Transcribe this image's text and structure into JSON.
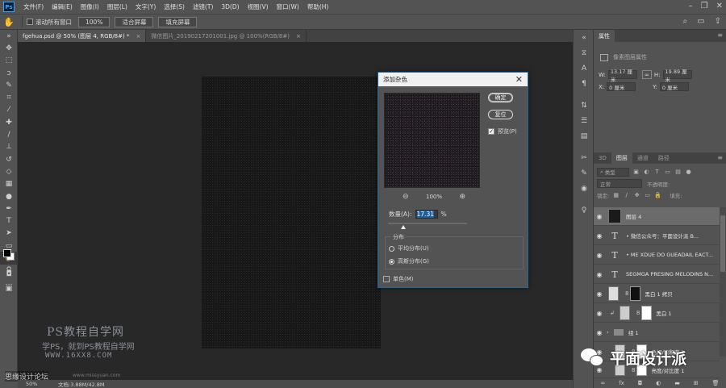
{
  "menubar": {
    "logo": "Ps",
    "items": [
      "文件(F)",
      "编辑(E)",
      "图像(I)",
      "图层(L)",
      "文字(Y)",
      "选择(S)",
      "滤镜(T)",
      "3D(D)",
      "视图(V)",
      "窗口(W)",
      "帮助(H)"
    ]
  },
  "optionsbar": {
    "scroll_all_label": "滚动所有窗口",
    "zoom_value": "100%",
    "fit_screen": "适合屏幕",
    "fill_screen": "填充屏幕"
  },
  "tabs": [
    {
      "label": "fgehua.psd @ 50% (图层 4, RGB/8#) *",
      "close": "×"
    },
    {
      "label": "微信图片_20190217201001.jpg @ 100%(RGB/8#)",
      "close": "×"
    }
  ],
  "dialog": {
    "title": "添加杂色",
    "close": "✕",
    "ok_label": "确定",
    "reset_label": "复位",
    "preview_label": "预览(P)",
    "preview_checked": true,
    "zoom": "100%",
    "amount_label": "数量(A):",
    "amount_value": "17.31",
    "amount_unit": "%",
    "distribution_label": "分布",
    "uniform_label": "平均分布(U)",
    "gaussian_label": "高斯分布(G)",
    "selected_distribution": "gaussian",
    "mono_label": "单色(M)",
    "mono_checked": false
  },
  "watermark": {
    "line1": "PS教程自学网",
    "line2": "学PS，就到PS教程自学网",
    "line3": "WWW.16XX8.COM",
    "line4": "思缘设计论坛",
    "line5": "www.missyuan.com"
  },
  "status": {
    "zoom": "50%",
    "doc": "文档:3.88M/42.8M"
  },
  "properties": {
    "tab": "属性",
    "subtitle": "像素图层属性",
    "w_label": "W:",
    "w_value": "13.17 厘米",
    "h_label": "H:",
    "h_value": "19.89 厘米",
    "x_label": "X:",
    "x_value": "0 厘米",
    "y_label": "Y:",
    "y_value": "0 厘米"
  },
  "layers_panel": {
    "tabs": [
      "3D",
      "图层",
      "通道",
      "路径"
    ],
    "active_tab": "图层",
    "filter": "类型",
    "blend": "正常",
    "opacity": "不透明度:",
    "lock": "锁定:",
    "fill": "填充:",
    "layers": [
      {
        "name": "图层 4",
        "kind": "pixel",
        "selected": true
      },
      {
        "name": "• 微信公众号：平面设计派 B...",
        "kind": "text"
      },
      {
        "name": "• ME XDUE DO GUEADAIL EACT...",
        "kind": "text"
      },
      {
        "name": "SEGMGA PRESING MELODINS N...",
        "kind": "text"
      },
      {
        "name": "黑白 1 拷贝",
        "kind": "adjust"
      },
      {
        "name": "黑白 1",
        "kind": "adjust"
      },
      {
        "name": "组 1",
        "kind": "group"
      },
      {
        "name": "色相/饱和度 1",
        "kind": "adjust"
      },
      {
        "name": "亮度/对比度 1",
        "kind": "adjust"
      }
    ]
  },
  "wechat": {
    "text": "平面设计派"
  }
}
